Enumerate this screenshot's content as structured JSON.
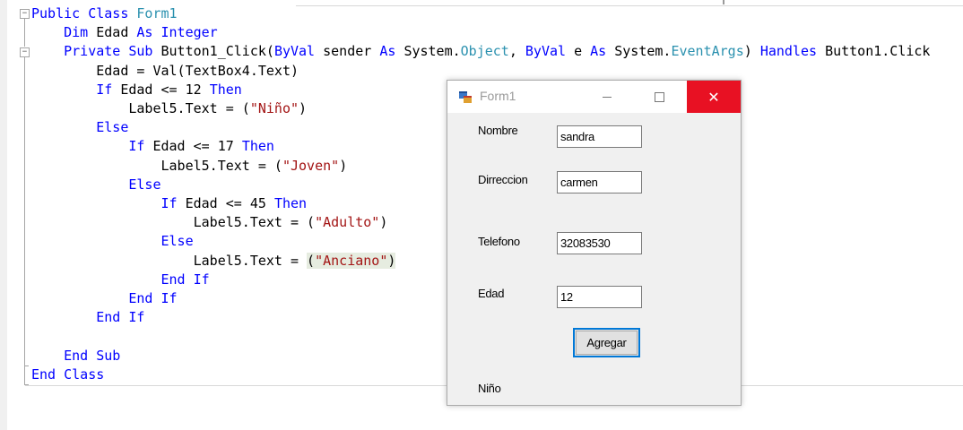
{
  "code": {
    "lines": [
      [
        {
          "t": "Public Class ",
          "c": "kw"
        },
        {
          "t": "Form1",
          "c": "ty"
        }
      ],
      [
        {
          "t": "    "
        },
        {
          "t": "Dim ",
          "c": "kw"
        },
        {
          "t": "Edad "
        },
        {
          "t": "As Integer",
          "c": "kw"
        }
      ],
      [
        {
          "t": "    "
        },
        {
          "t": "Private Sub ",
          "c": "kw"
        },
        {
          "t": "Button1_Click("
        },
        {
          "t": "ByVal ",
          "c": "kw"
        },
        {
          "t": "sender "
        },
        {
          "t": "As ",
          "c": "kw"
        },
        {
          "t": "System."
        },
        {
          "t": "Object",
          "c": "ty"
        },
        {
          "t": ", "
        },
        {
          "t": "ByVal ",
          "c": "kw"
        },
        {
          "t": "e "
        },
        {
          "t": "As ",
          "c": "kw"
        },
        {
          "t": "System."
        },
        {
          "t": "EventArgs",
          "c": "ty"
        },
        {
          "t": ") "
        },
        {
          "t": "Handles ",
          "c": "kw"
        },
        {
          "t": "Button1.Click"
        }
      ],
      [
        {
          "t": "        Edad = Val(TextBox4.Text)"
        }
      ],
      [
        {
          "t": "        "
        },
        {
          "t": "If ",
          "c": "kw"
        },
        {
          "t": "Edad <= 12 "
        },
        {
          "t": "Then",
          "c": "kw"
        }
      ],
      [
        {
          "t": "            Label5.Text = ("
        },
        {
          "t": "\"Niño\"",
          "c": "st"
        },
        {
          "t": ")"
        }
      ],
      [
        {
          "t": "        "
        },
        {
          "t": "Else",
          "c": "kw"
        }
      ],
      [
        {
          "t": "            "
        },
        {
          "t": "If ",
          "c": "kw"
        },
        {
          "t": "Edad <= 17 "
        },
        {
          "t": "Then",
          "c": "kw"
        }
      ],
      [
        {
          "t": "                Label5.Text = ("
        },
        {
          "t": "\"Joven\"",
          "c": "st"
        },
        {
          "t": ")"
        }
      ],
      [
        {
          "t": "            "
        },
        {
          "t": "Else",
          "c": "kw"
        }
      ],
      [
        {
          "t": "                "
        },
        {
          "t": "If ",
          "c": "kw"
        },
        {
          "t": "Edad <= 45 "
        },
        {
          "t": "Then",
          "c": "kw"
        }
      ],
      [
        {
          "t": "                    Label5.Text = ("
        },
        {
          "t": "\"Adulto\"",
          "c": "st"
        },
        {
          "t": ")"
        }
      ],
      [
        {
          "t": "                "
        },
        {
          "t": "Else",
          "c": "kw"
        }
      ],
      [
        {
          "t": "                    Label5.Text = "
        },
        {
          "t": "(",
          "c": "hl"
        },
        {
          "t": "\"Anciano\"",
          "c": "st hl"
        },
        {
          "t": ")",
          "c": "hl"
        }
      ],
      [
        {
          "t": "                "
        },
        {
          "t": "End If",
          "c": "kw"
        }
      ],
      [
        {
          "t": "            "
        },
        {
          "t": "End If",
          "c": "kw"
        }
      ],
      [
        {
          "t": "        "
        },
        {
          "t": "End If",
          "c": "kw"
        }
      ],
      [],
      [
        {
          "t": "    "
        },
        {
          "t": "End Sub",
          "c": "kw"
        }
      ],
      [
        {
          "t": "End Class",
          "c": "kw"
        }
      ]
    ]
  },
  "form": {
    "title": "Form1",
    "close_symbol": "✕",
    "fields": [
      {
        "label": "Nombre",
        "value": "sandra"
      },
      {
        "label": "Dirreccion",
        "value": "carmen"
      },
      {
        "label": "Telefono",
        "value": "32083530"
      },
      {
        "label": "Edad",
        "value": "12"
      }
    ],
    "button_label": "Agregar",
    "result_label": "Niño"
  },
  "colors": {
    "keyword": "#0000ff",
    "type": "#2b91af",
    "string": "#a31515",
    "close_button": "#e81123",
    "focus_border": "#0078d7"
  },
  "icons": [
    "collapse-icon",
    "form-app-icon",
    "minimize-icon",
    "maximize-icon",
    "close-icon"
  ]
}
